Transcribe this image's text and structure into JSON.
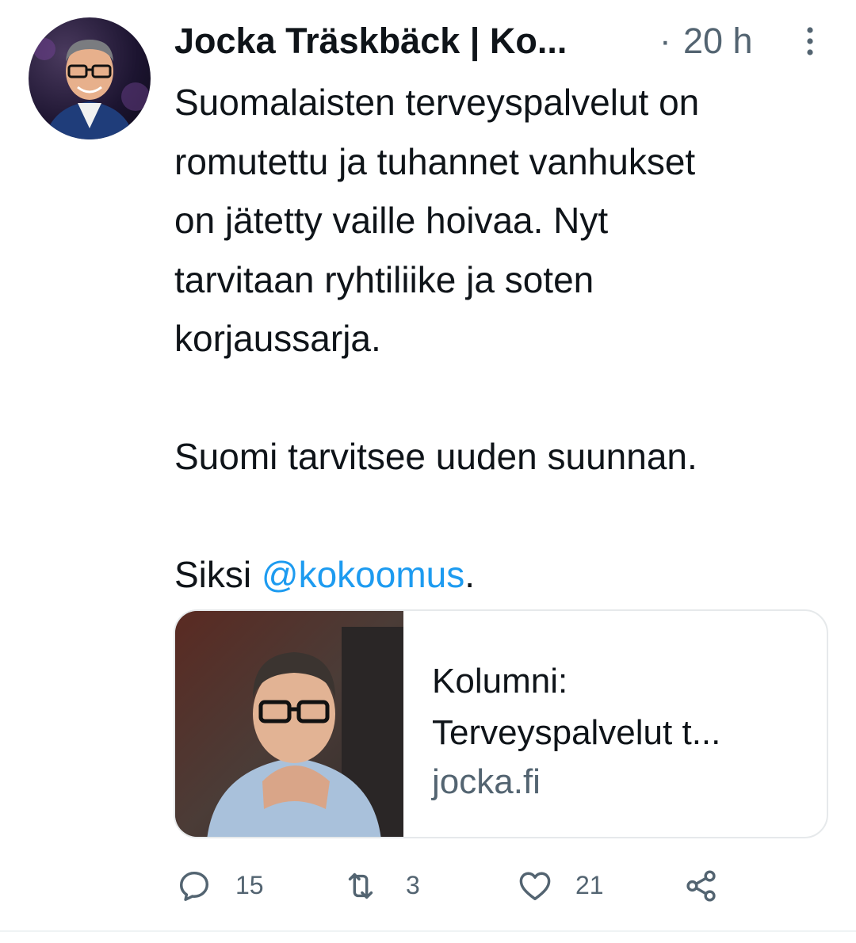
{
  "tweet": {
    "author_name": "Jocka Träskbäck | Ko...",
    "separator": "·",
    "time": "20 h",
    "body_lines": [
      "Suomalaisten terveyspalvelut on",
      "romutettu ja tuhannet vanhukset",
      "on jätetty vaille hoivaa. Nyt",
      "tarvitaan ryhtiliike ja soten",
      "korjaussarja."
    ],
    "body_line_6": "Suomi tarvitsee uuden suunnan.",
    "body_prefix": "Siksi ",
    "mention": "@kokoomus",
    "body_suffix": ".",
    "card": {
      "title_line_1": "Kolumni:",
      "title_line_2": "Terveyspalvelut t...",
      "domain": "jocka.fi"
    },
    "actions": {
      "reply_count": "15",
      "retweet_count": "3",
      "like_count": "21"
    }
  },
  "colors": {
    "text": "#0f1419",
    "secondary": "#536471",
    "link": "#1d9bf0",
    "border": "#e6e9eb"
  },
  "icons": {
    "reply": "reply-icon",
    "retweet": "retweet-icon",
    "like": "heart-icon",
    "share": "share-icon",
    "more": "more-vertical-icon"
  }
}
